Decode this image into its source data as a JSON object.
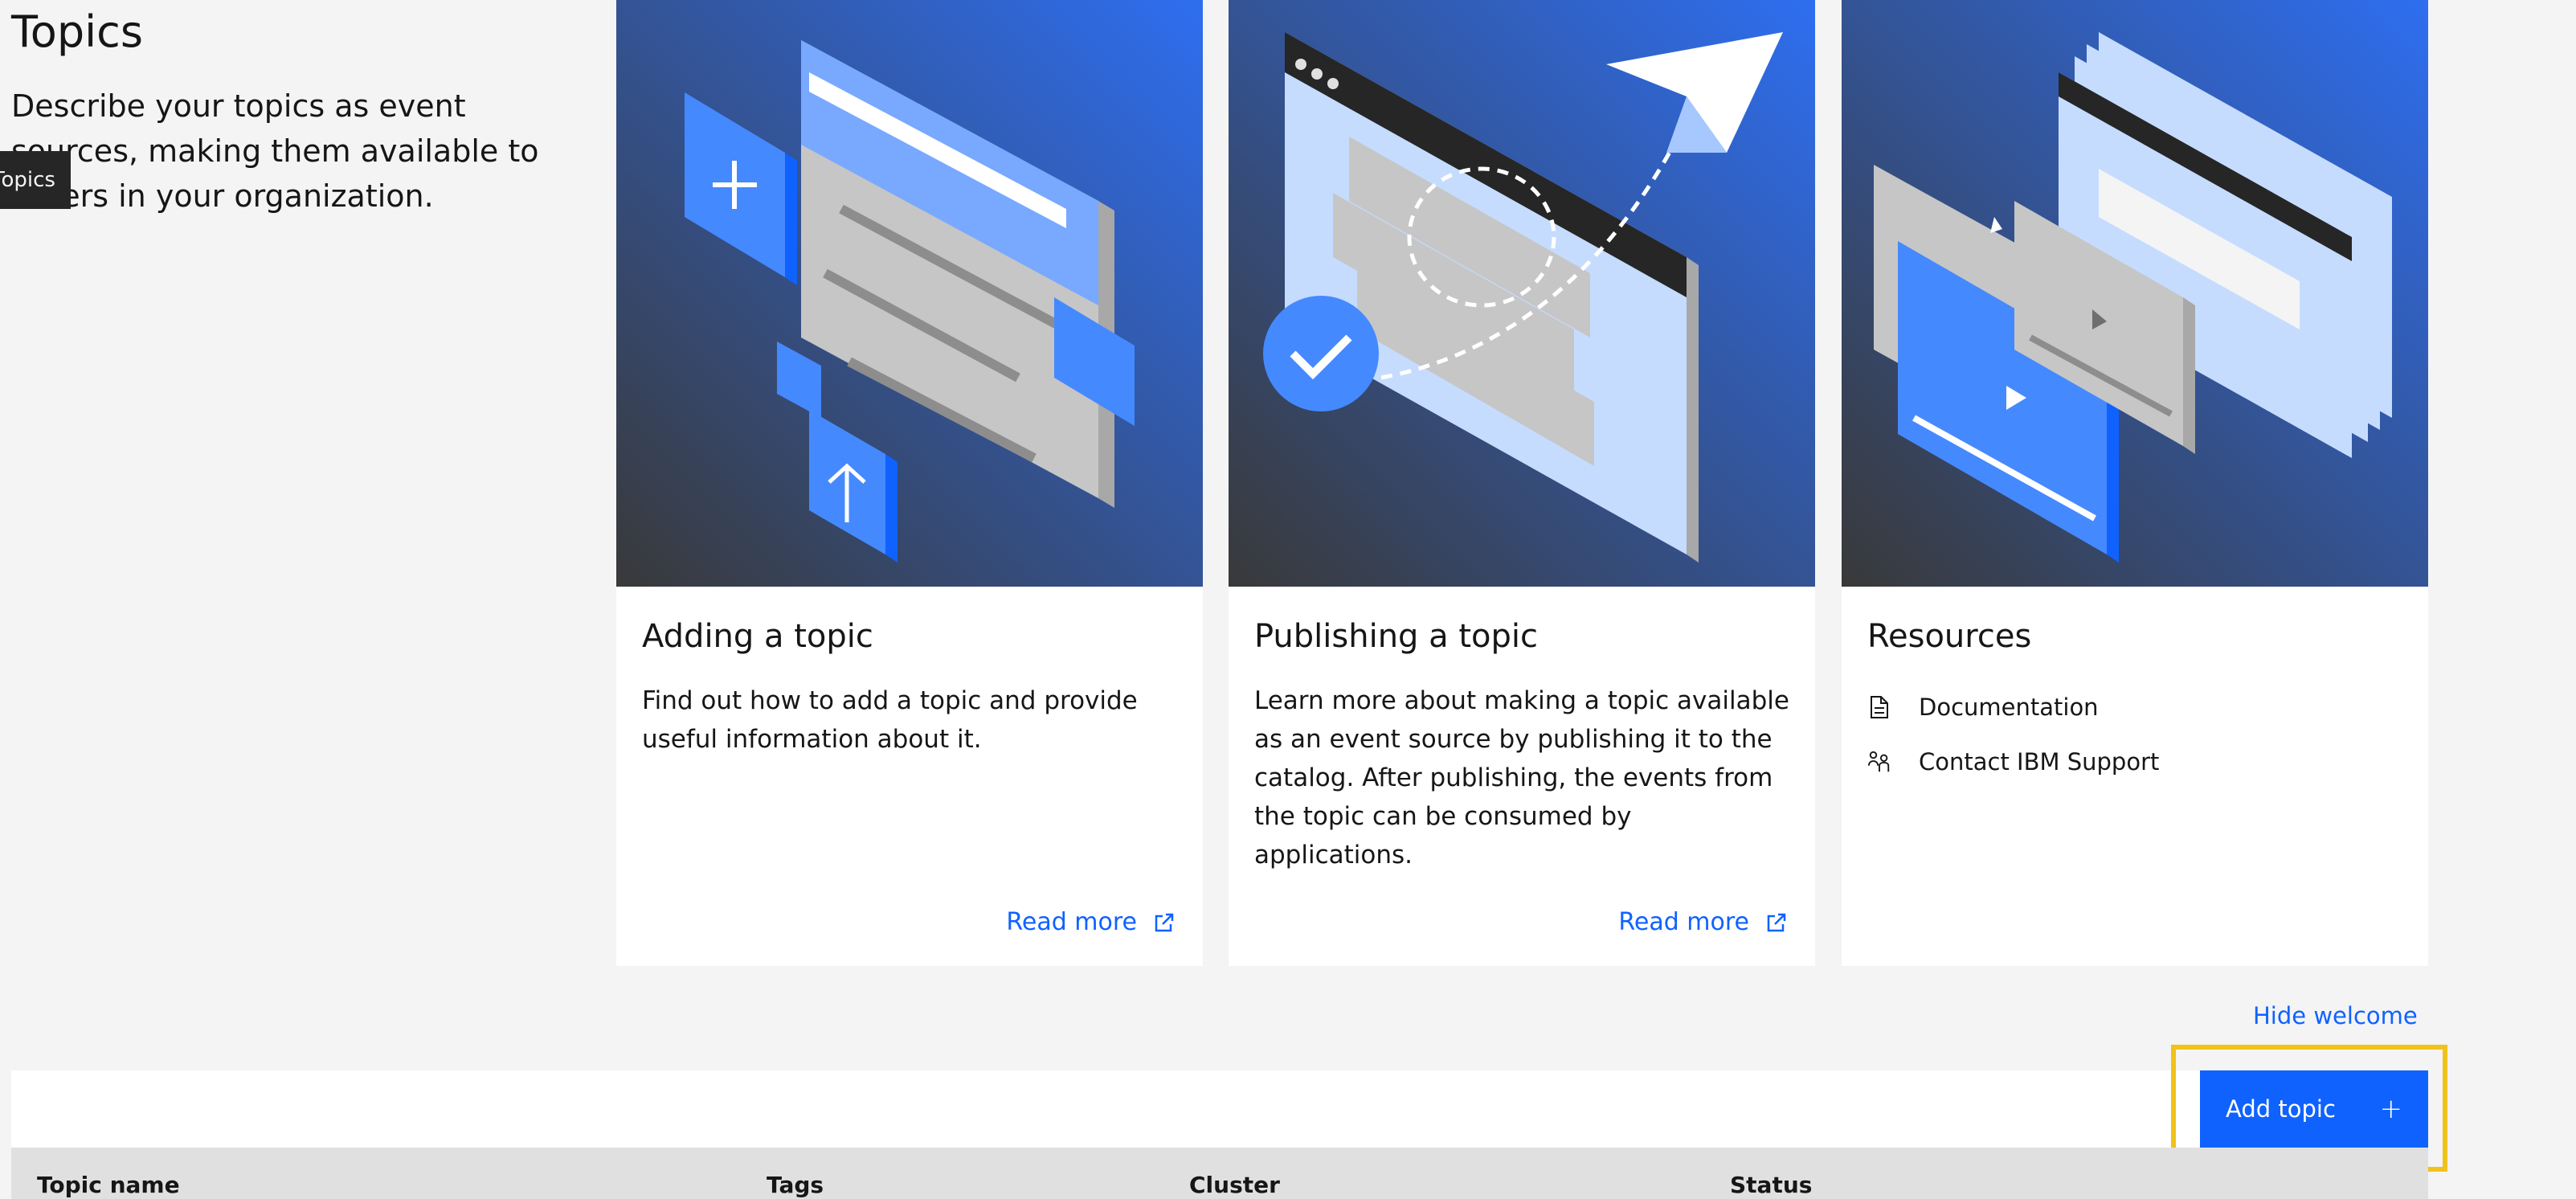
{
  "page": {
    "title": "Topics",
    "description": "Describe your topics as event sources, making them available to others in your organization.",
    "tooltip": "Topics"
  },
  "cards": [
    {
      "title": "Adding a topic",
      "description": "Find out how to add a topic and provide useful information about it.",
      "link": "Read more"
    },
    {
      "title": "Publishing a topic",
      "description": "Learn more about making a topic available as an event source by publishing it to the catalog. After publishing, the events from the topic can be consumed by applications.",
      "link": "Read more"
    },
    {
      "title": "Resources",
      "items": [
        {
          "label": "Documentation",
          "icon": "document-icon"
        },
        {
          "label": "Contact IBM Support",
          "icon": "support-icon"
        }
      ]
    }
  ],
  "hide_welcome": "Hide welcome",
  "add_topic": {
    "label": "Add topic",
    "icon": "+"
  },
  "table": {
    "columns": [
      "Topic name",
      "Tags",
      "Cluster",
      "Status"
    ]
  },
  "colors": {
    "accent": "#0f62fe",
    "highlight": "#f1c21b",
    "background": "#f4f4f4"
  }
}
